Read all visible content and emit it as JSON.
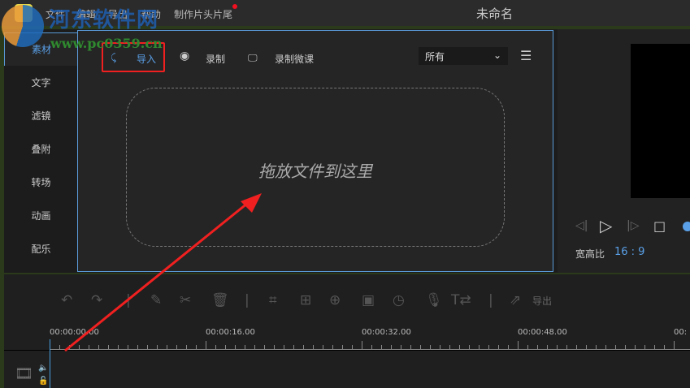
{
  "menu": [
    "文件",
    "编辑",
    "导出",
    "帮助",
    "制作片头片尾"
  ],
  "window_title": "未命名",
  "sidebar_tabs": [
    "素材",
    "文字",
    "滤镜",
    "叠附",
    "转场",
    "动画",
    "配乐"
  ],
  "toolbar": {
    "import": "导入",
    "record": "录制",
    "record_lesson": "录制微课",
    "filter_value": "所有"
  },
  "drop_hint": "拖放文件到这里",
  "preview": {
    "aspect_label": "宽高比",
    "aspect_value": "16 : 9"
  },
  "timeline": {
    "export": "导出",
    "timecodes": [
      "00:00:00.00",
      "00:00:16.00",
      "00:00:32.00",
      "00:00:48.00"
    ]
  },
  "watermark": {
    "name": "河东软件网",
    "url": "www.pc0359.cn"
  },
  "colors": {
    "accent": "#5aa0e8",
    "highlight": "#f02020"
  }
}
